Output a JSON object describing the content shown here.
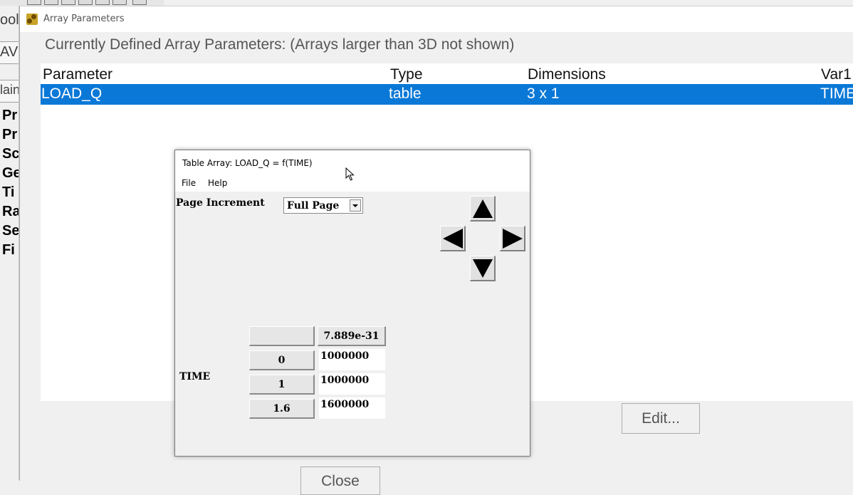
{
  "background_app": {
    "fragments": [
      "ool",
      "AV",
      "lain"
    ],
    "bold_fragments": [
      "Pr",
      "Pr",
      "Sc",
      "Ge",
      "Ti",
      "Ra",
      "Se",
      "Fi"
    ]
  },
  "array_window": {
    "title": "Array Parameters",
    "heading": "Currently Defined Array Parameters: (Arrays larger than 3D not shown)",
    "columns": [
      "Parameter",
      "Type",
      "Dimensions",
      "Var1"
    ],
    "rows": [
      {
        "parameter": "LOAD_Q",
        "type": "table",
        "dimensions": "3 x 1",
        "var1": "TIME"
      }
    ],
    "edit_label": "Edit...",
    "close_label": "Close"
  },
  "table_window": {
    "title": "Table Array: LOAD_Q = f(TIME)",
    "menu": [
      "File",
      "Help"
    ],
    "page_increment_label": "Page Increment",
    "page_increment_value": "Full Page",
    "column_header": "7.889e-31",
    "row_axis_label": "TIME",
    "rows": [
      {
        "index": "0",
        "value": "1000000"
      },
      {
        "index": "1",
        "value": "1000000"
      },
      {
        "index": "1.6",
        "value": "1600000"
      }
    ]
  },
  "colors": {
    "selection": "#0a78d7",
    "window_bg": "#f0f0f0"
  }
}
